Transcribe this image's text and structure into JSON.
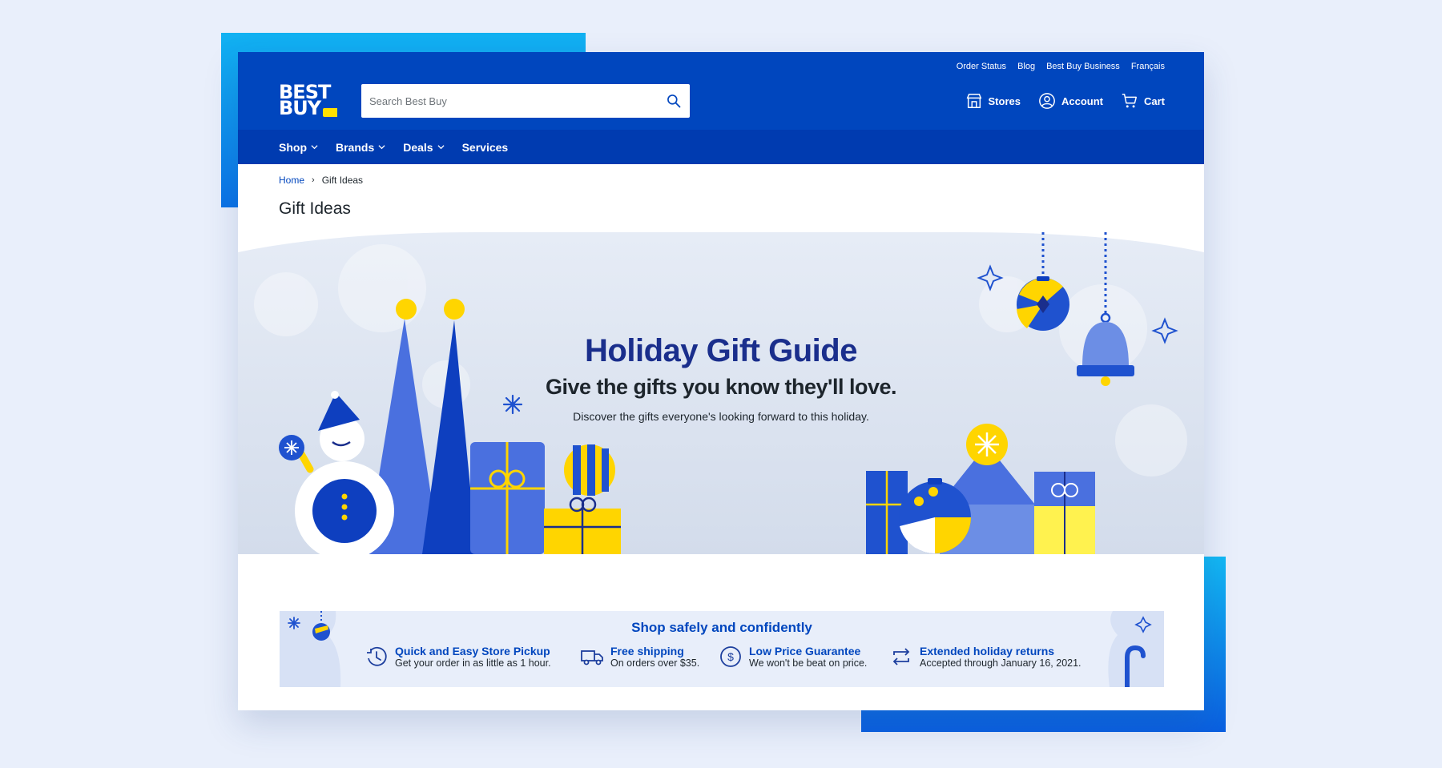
{
  "colors": {
    "brand_blue": "#0046be",
    "nav_blue": "#003bb0",
    "brand_yellow": "#ffe000",
    "hero_title": "#1a2e8c"
  },
  "header": {
    "logo": {
      "line1": "BEST",
      "line2": "BUY"
    },
    "utility_links": [
      "Order Status",
      "Blog",
      "Best Buy Business",
      "Français"
    ],
    "search": {
      "placeholder": "Search Best Buy",
      "value": "",
      "icon": "search-icon"
    },
    "actions": [
      {
        "label": "Stores",
        "icon": "store-icon"
      },
      {
        "label": "Account",
        "icon": "account-icon"
      },
      {
        "label": "Cart",
        "icon": "cart-icon"
      }
    ]
  },
  "nav": {
    "items": [
      {
        "label": "Shop",
        "has_menu": true
      },
      {
        "label": "Brands",
        "has_menu": true
      },
      {
        "label": "Deals",
        "has_menu": true
      },
      {
        "label": "Services",
        "has_menu": false
      }
    ]
  },
  "breadcrumb": {
    "items": [
      "Home",
      "Gift Ideas"
    ],
    "separator": "›"
  },
  "page_title": "Gift Ideas",
  "hero": {
    "title": "Holiday Gift Guide",
    "subtitle": "Give the gifts you know they'll love.",
    "description": "Discover the gifts everyone's looking forward to this holiday."
  },
  "shop_safely": {
    "title": "Shop safely and confidently",
    "features": [
      {
        "icon": "clock-icon",
        "title": "Quick and Easy Store Pickup",
        "subtitle": "Get your order in as little as 1 hour."
      },
      {
        "icon": "truck-icon",
        "title": "Free shipping",
        "subtitle": "On orders over $35."
      },
      {
        "icon": "dollar-icon",
        "title": "Low Price Guarantee",
        "subtitle": "We won't be beat on price."
      },
      {
        "icon": "return-icon",
        "title": "Extended holiday returns",
        "subtitle": "Accepted through January 16, 2021."
      }
    ]
  }
}
